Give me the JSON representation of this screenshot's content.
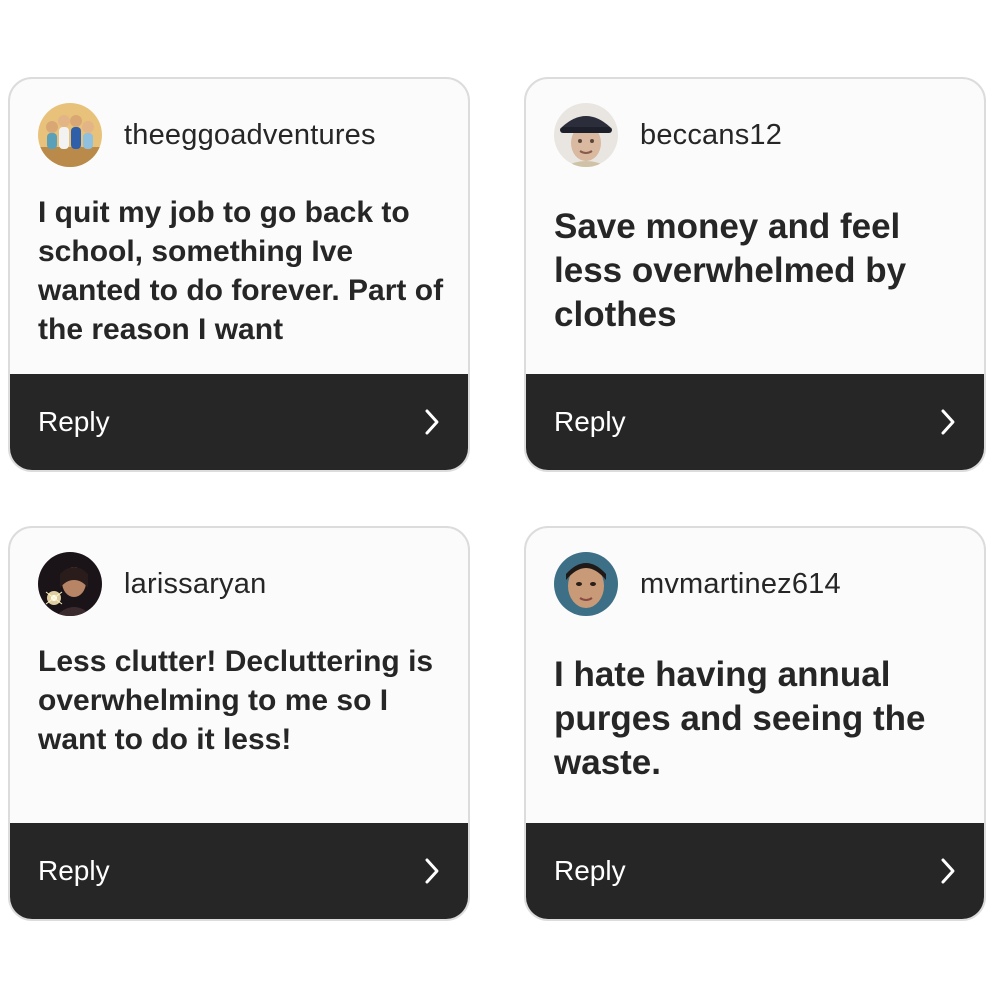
{
  "cards": [
    {
      "username": "theeggoadventures",
      "message": "I quit my job to go back to school, something Ive wanted to do forever. Part of the reason I want",
      "reply_label": "Reply",
      "avatar_icon": "avatar-eggo-figures"
    },
    {
      "username": "beccans12",
      "message": "Save money and feel less overwhelmed by clothes",
      "reply_label": "Reply",
      "avatar_icon": "avatar-person-hat"
    },
    {
      "username": "larissaryan",
      "message": "Less clutter! Decluttering is overwhelming to me so I want to do it less!",
      "reply_label": "Reply",
      "avatar_icon": "avatar-person-sparkler"
    },
    {
      "username": "mvmartinez614",
      "message": "I hate having annual purges and seeing the waste.",
      "reply_label": "Reply",
      "avatar_icon": "avatar-person-portrait"
    }
  ],
  "colors": {
    "reply_bar": "#262626",
    "card_border": "#dcdcdc",
    "text": "#262626"
  }
}
